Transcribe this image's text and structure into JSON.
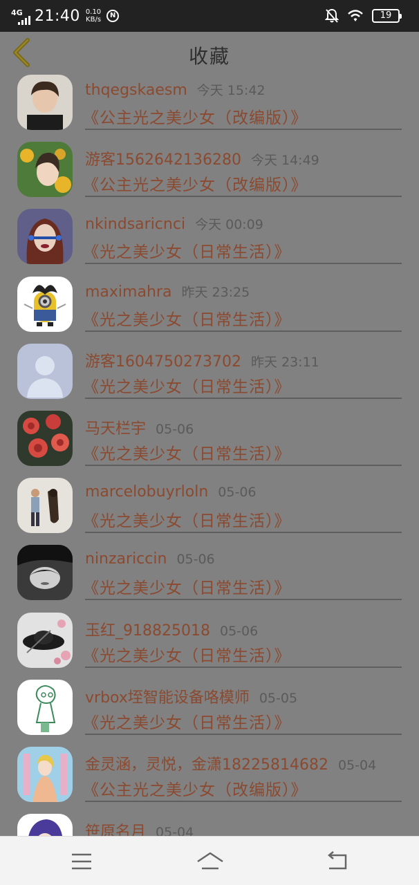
{
  "status_bar": {
    "network": "4G",
    "time": "21:40",
    "speed_value": "0.10",
    "speed_unit": "KB/s",
    "circle_badge": "Ⓝ",
    "battery": "19",
    "icons": [
      "signal-icon",
      "bell-off-icon",
      "wifi-icon",
      "battery-icon"
    ]
  },
  "header": {
    "back_icon": "chevron-left-icon",
    "title": "收藏"
  },
  "favorites": [
    {
      "user": "thqegskaesm",
      "time": "今天 15:42",
      "title": "《公主光之美少女（改编版）》",
      "avatar": "boy-portrait"
    },
    {
      "user": "游客1562642136280",
      "time": "今天 14:49",
      "title": "《公主光之美少女（改编版）》",
      "avatar": "anime-sunflower"
    },
    {
      "user": "nkindsaricnci",
      "time": "今天 00:09",
      "title": "《光之美少女（日常生活）》",
      "avatar": "woman-portrait"
    },
    {
      "user": "maximahra",
      "time": "昨天 23:25",
      "title": "《光之美少女（日常生活）》",
      "avatar": "minion"
    },
    {
      "user": "游客1604750273702",
      "time": "昨天 23:11",
      "title": "《光之美少女（日常生活）》",
      "avatar": "default-silhouette"
    },
    {
      "user": "马天栏宇",
      "time": "05-06",
      "title": "《光之美少女（日常生活）》",
      "avatar": "red-flowers"
    },
    {
      "user": "marcelobuyrloln",
      "time": "05-06",
      "title": "《光之美少女（日常生活）》",
      "avatar": "man-with-dog"
    },
    {
      "user": "ninzariccin",
      "time": "05-06",
      "title": "《光之美少女（日常生活）》",
      "avatar": "bw-portrait"
    },
    {
      "user": "玉红_918825018",
      "time": "05-06",
      "title": "《光之美少女（日常生活）》",
      "avatar": "hat-and-flowers"
    },
    {
      "user": "vrbox垤智能设备咯模师",
      "time": "05-05",
      "title": "《光之美少女（日常生活）》",
      "avatar": "sketch-girl"
    },
    {
      "user": "金灵涵，灵悦，金潇18225814682",
      "time": "05-04",
      "title": "《公主光之美少女（改编版）》",
      "avatar": "anime-princess"
    },
    {
      "user": "笹原名月",
      "time": "05-04",
      "title": "",
      "avatar": "anime-purple-hair"
    }
  ],
  "bottom_nav": {
    "icons": [
      "menu-icon",
      "home-icon",
      "back-icon"
    ]
  }
}
